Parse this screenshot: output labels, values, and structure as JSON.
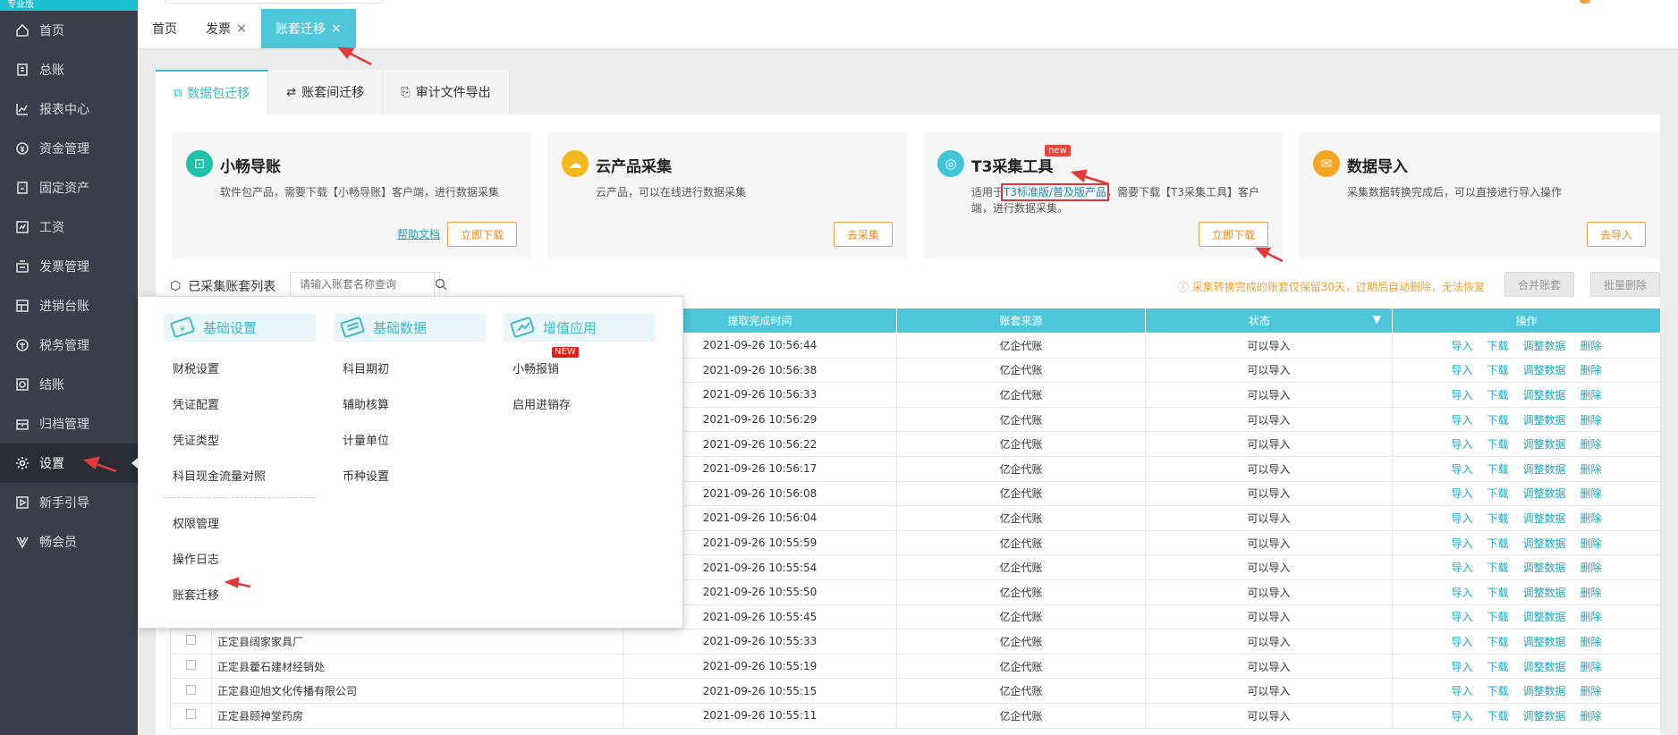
{
  "sidebar": {
    "logo": "专业版",
    "items": [
      {
        "label": "首页",
        "icon": "home-icon"
      },
      {
        "label": "总账",
        "icon": "ledger-icon"
      },
      {
        "label": "报表中心",
        "icon": "chart-icon"
      },
      {
        "label": "资金管理",
        "icon": "money-icon"
      },
      {
        "label": "固定资产",
        "icon": "building-icon"
      },
      {
        "label": "工资",
        "icon": "salary-icon"
      },
      {
        "label": "发票管理",
        "icon": "invoice-icon"
      },
      {
        "label": "进销台账",
        "icon": "stock-icon"
      },
      {
        "label": "税务管理",
        "icon": "tax-icon"
      },
      {
        "label": "结账",
        "icon": "checkout-icon"
      },
      {
        "label": "归档管理",
        "icon": "archive-icon"
      },
      {
        "label": "设置",
        "icon": "gear-icon",
        "active": true
      },
      {
        "label": "新手引导",
        "icon": "play-icon"
      },
      {
        "label": "畅会员",
        "icon": "vip-icon"
      }
    ]
  },
  "page_tabs": [
    {
      "label": "首页"
    },
    {
      "label": "发票",
      "closable": true
    },
    {
      "label": "账套迁移",
      "closable": true,
      "active": true
    }
  ],
  "sub_tabs": [
    {
      "label": "数据包迁移",
      "active": true
    },
    {
      "label": "账套间迁移"
    },
    {
      "label": "审计文件导出"
    }
  ],
  "cards": [
    {
      "title": "小畅导账",
      "desc": "软件包产品，需要下载【小畅导账】客户端，进行数据采集",
      "link": "帮助文档",
      "button": "立即下载",
      "color": "#1fc1a8"
    },
    {
      "title": "云产品采集",
      "desc": "云产品，可以在线进行数据采集",
      "button": "去采集",
      "color": "#f2b81e"
    },
    {
      "title": "T3采集工具",
      "badge": "new",
      "desc_prefix": "适用于",
      "desc_highlight": "T3标准版/普及版产品",
      "desc_suffix": "，需要下载【T3采集工具】客户",
      "desc_line2": "端，进行数据采集。",
      "button": "立即下载",
      "color": "#3fc6d8"
    },
    {
      "title": "数据导入",
      "desc": "采集数据转换完成后，可以直接进行导入操作",
      "button": "去导入",
      "color": "#f5a623"
    }
  ],
  "list": {
    "title": "已采集账套列表",
    "search_placeholder": "请输入账套名称查询",
    "notice": "ⓘ 采集转换完成的账套仅保留30天，过期后自动删除，无法恢复",
    "merge_button": "合并账套",
    "batch_delete_button": "批量删除"
  },
  "table": {
    "headers": [
      "",
      "",
      "提取完成时间",
      "账套来源",
      "状态",
      "操作"
    ],
    "actions": [
      "导入",
      "下载",
      "调整数据",
      "删除"
    ],
    "rows": [
      {
        "name": "",
        "time": "2021-09-26 10:56:44",
        "source": "亿企代账",
        "status": "可以导入"
      },
      {
        "name": "",
        "time": "2021-09-26 10:56:38",
        "source": "亿企代账",
        "status": "可以导入"
      },
      {
        "name": "",
        "time": "2021-09-26 10:56:33",
        "source": "亿企代账",
        "status": "可以导入"
      },
      {
        "name": "",
        "time": "2021-09-26 10:56:29",
        "source": "亿企代账",
        "status": "可以导入"
      },
      {
        "name": "",
        "time": "2021-09-26 10:56:22",
        "source": "亿企代账",
        "status": "可以导入"
      },
      {
        "name": "",
        "time": "2021-09-26 10:56:17",
        "source": "亿企代账",
        "status": "可以导入"
      },
      {
        "name": "",
        "time": "2021-09-26 10:56:08",
        "source": "亿企代账",
        "status": "可以导入"
      },
      {
        "name": "",
        "time": "2021-09-26 10:56:04",
        "source": "亿企代账",
        "status": "可以导入"
      },
      {
        "name": "",
        "time": "2021-09-26 10:55:59",
        "source": "亿企代账",
        "status": "可以导入"
      },
      {
        "name": "",
        "time": "2021-09-26 10:55:54",
        "source": "亿企代账",
        "status": "可以导入"
      },
      {
        "name": "",
        "time": "2021-09-26 10:55:50",
        "source": "亿企代账",
        "status": "可以导入"
      },
      {
        "name": "",
        "time": "2021-09-26 10:55:45",
        "source": "亿企代账",
        "status": "可以导入"
      },
      {
        "name": "正定县阔家家具厂",
        "time": "2021-09-26 10:55:33",
        "source": "亿企代账",
        "status": "可以导入"
      },
      {
        "name": "正定县藿石建材经销处",
        "time": "2021-09-26 10:55:19",
        "source": "亿企代账",
        "status": "可以导入"
      },
      {
        "name": "正定县迎旭文化传播有限公司",
        "time": "2021-09-26 10:55:15",
        "source": "亿企代账",
        "status": "可以导入"
      },
      {
        "name": "正定县颐神堂药房",
        "time": "2021-09-26 10:55:11",
        "source": "亿企代账",
        "status": "可以导入"
      }
    ]
  },
  "dropdown": {
    "columns": [
      {
        "title": "基础设置",
        "items": [
          "财税设置",
          "凭证配置",
          "凭证类型",
          "科目现金流量对照"
        ],
        "items_after_divider": [
          "权限管理",
          "操作日志",
          "账套迁移"
        ]
      },
      {
        "title": "基础数据",
        "items": [
          "科目期初",
          "辅助核算",
          "计量单位",
          "币种设置"
        ]
      },
      {
        "title": "增值应用",
        "items": [
          "小畅报销",
          "启用进销存"
        ],
        "badge": "NEW"
      }
    ]
  },
  "colors": {
    "accent": "#4dc7d9",
    "sidebar": "#3b3e4a",
    "orange": "#f08a20",
    "arrow": "#e03a3a"
  }
}
